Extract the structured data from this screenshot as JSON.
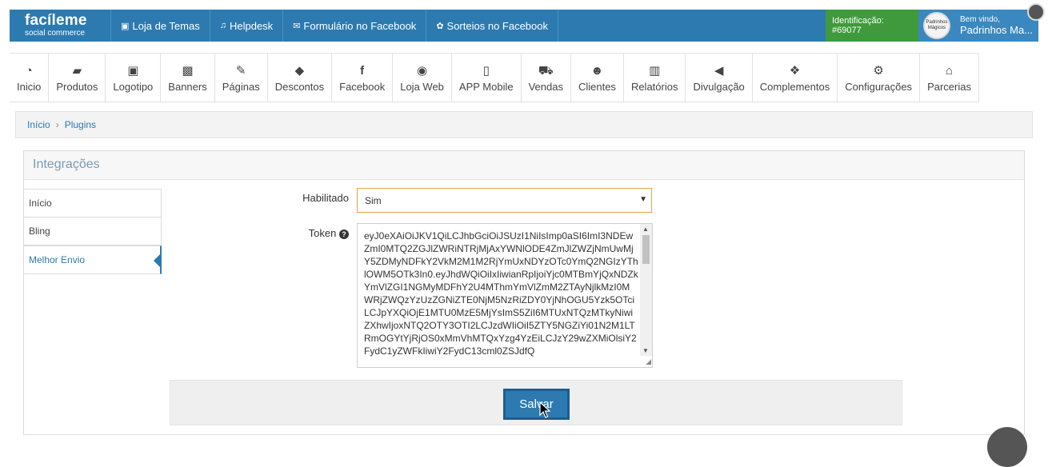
{
  "topbar": {
    "logo_line1": "facíleme",
    "logo_line2": "social commerce",
    "links": [
      {
        "icon": "image-icon",
        "glyph": "▣",
        "label": "Loja de Temas"
      },
      {
        "icon": "headphones-icon",
        "glyph": "♫",
        "label": "Helpdesk"
      },
      {
        "icon": "envelope-icon",
        "glyph": "✉",
        "label": "Formulário no Facebook"
      },
      {
        "icon": "gift-icon",
        "glyph": "✿",
        "label": "Sorteios no Facebook"
      }
    ],
    "identification": "Identificação: #69077",
    "avatar_text": "Padrinhos Mágicos",
    "welcome": "Bem vindo,",
    "user_name": "Padrinhos Ma..."
  },
  "nav": [
    {
      "icon": "dashboard-icon",
      "glyph": "◔",
      "label": "Inicio"
    },
    {
      "icon": "folder-icon",
      "glyph": "▰",
      "label": "Produtos"
    },
    {
      "icon": "image-file-icon",
      "glyph": "▣",
      "label": "Logotipo"
    },
    {
      "icon": "picture-icon",
      "glyph": "▩",
      "label": "Banners"
    },
    {
      "icon": "edit-icon",
      "glyph": "✎",
      "label": "Páginas"
    },
    {
      "icon": "tags-icon",
      "glyph": "◆",
      "label": "Descontos"
    },
    {
      "icon": "facebook-icon",
      "glyph": "f",
      "label": "Facebook"
    },
    {
      "icon": "globe-icon",
      "glyph": "◉",
      "label": "Loja Web"
    },
    {
      "icon": "mobile-icon",
      "glyph": "▯",
      "label": "APP Mobile"
    },
    {
      "icon": "cart-icon",
      "glyph": "⛟",
      "label": "Vendas"
    },
    {
      "icon": "users-icon",
      "glyph": "☻",
      "label": "Clientes"
    },
    {
      "icon": "bar-chart-icon",
      "glyph": "▥",
      "label": "Relatórios"
    },
    {
      "icon": "bullhorn-icon",
      "glyph": "◀",
      "label": "Divulgação"
    },
    {
      "icon": "cubes-icon",
      "glyph": "❖",
      "label": "Complementos"
    },
    {
      "icon": "cogs-icon",
      "glyph": "⚙",
      "label": "Configurações"
    },
    {
      "icon": "bank-icon",
      "glyph": "⌂",
      "label": "Parcerias"
    }
  ],
  "breadcrumb": {
    "home": "Início",
    "separator": "›",
    "current": "Plugins"
  },
  "panel": {
    "title": "Integrações"
  },
  "sidetabs": [
    "Início",
    "Bling",
    "Melhor Envio"
  ],
  "form": {
    "enabled_label": "Habilitado",
    "enabled_value": "Sim",
    "token_label": "Token",
    "token_value": "eyJ0eXAiOiJKV1QiLCJhbGciOiJSUzI1NiIsImp0aSI6ImI3NDEwZmI0MTQ2ZGJlZWRiNTRjMjAxYWNlODE4ZmJlZWZjNmUwMjY5ZDMyNDFkY2VkM2M1M2RjYmUxNDYzOTc0YmQ2NGIzYThlOWM5OTk3In0.eyJhdWQiOiIxIiwianRpIjoiYjc0MTBmYjQxNDZkYmVlZGI1NGMyMDFhY2U4MThmYmVlZmM2ZTAyNjlkMzI0MWRjZWQzYzUzZGNiZTE0NjM5NzRiZDY0YjNhOGU5Yzk5OTciLCJpYXQiOjE1MTU0MzE5MjYsImS5ZiI6MTUxNTQzMTkyNiwiZXhwIjoxNTQ2OTY3OTI2LCJzdWIiOiI5ZTY5NGZiYi01N2M1LTRmOGYtYjRjOS0xMmVhMTQxYzg4YzEiLCJzY29wZXMiOlsiY2FydC1yZWFkIiwiY2FydC13cml0ZSJdfQ",
    "save_label": "Salvar"
  }
}
